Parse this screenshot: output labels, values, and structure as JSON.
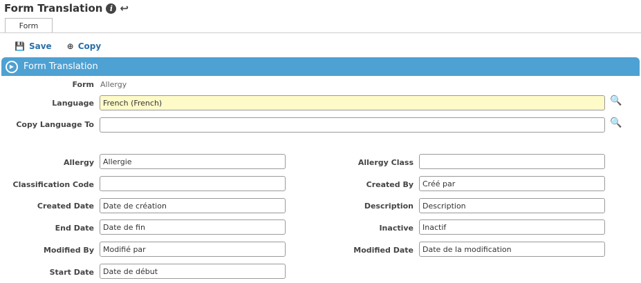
{
  "header": {
    "title": "Form Translation"
  },
  "tabs": [
    {
      "label": "Form"
    }
  ],
  "toolbar": {
    "save_label": "Save",
    "copy_label": "Copy"
  },
  "section": {
    "title": "Form Translation"
  },
  "form_info": {
    "form_label": "Form",
    "form_value": "Allergy",
    "language_label": "Language",
    "language_value": "French (French)",
    "copy_language_label": "Copy Language To",
    "copy_language_value": ""
  },
  "fields": {
    "allergy": {
      "label": "Allergy",
      "value": "Allergie"
    },
    "allergy_class": {
      "label": "Allergy Class",
      "value": ""
    },
    "classification_code": {
      "label": "Classification Code",
      "value": ""
    },
    "created_by": {
      "label": "Created By",
      "value": "Créé par"
    },
    "created_date": {
      "label": "Created Date",
      "value": "Date de création"
    },
    "description": {
      "label": "Description",
      "value": "Description"
    },
    "end_date": {
      "label": "End Date",
      "value": "Date de fin"
    },
    "inactive": {
      "label": "Inactive",
      "value": "Inactif"
    },
    "modified_by": {
      "label": "Modified By",
      "value": "Modifié par"
    },
    "modified_date": {
      "label": "Modified Date",
      "value": "Date de la modification"
    },
    "start_date": {
      "label": "Start Date",
      "value": "Date de début"
    }
  }
}
